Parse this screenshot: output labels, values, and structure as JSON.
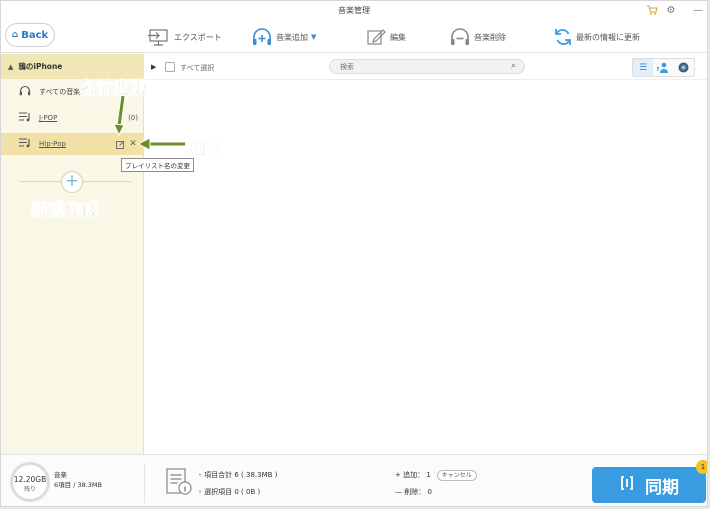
{
  "window": {
    "title": "音楽管理",
    "icons": [
      "cart-icon",
      "gear-icon",
      "minimize-icon"
    ]
  },
  "toolbar": {
    "back_label": "Back",
    "export_label": "エクスポート",
    "add_music_label": "音楽追加",
    "edit_label": "編集",
    "delete_music_label": "音楽削除",
    "refresh_label": "最新の情報に更新"
  },
  "sidebar": {
    "device_name": "鴉のiPhone",
    "items": [
      {
        "label": "すべての音楽",
        "count": "",
        "icon": "headphones-icon"
      },
      {
        "label": "J-POP",
        "count": "(0)",
        "icon": "playlist-icon"
      },
      {
        "label": "Hip-Pop",
        "count": "",
        "icon": "playlist-icon",
        "selected": true
      }
    ],
    "tooltip": "プレイリスト名の変更"
  },
  "content": {
    "select_all_label": "すべて選択",
    "search_placeholder": "検索"
  },
  "bottom": {
    "storage_value": "12.20GB",
    "storage_sub": "残り",
    "category": "音楽",
    "category_detail": "6項目 / 38.3MB",
    "total_items": "項目合計 6 ( 38.3MB )",
    "selected_items": "選択項目 0 ( 0B )",
    "add_label": "追加： 1",
    "cancel_label": "キャンセル",
    "delete_label": "削除： 0",
    "sync_label": "同期",
    "badge": "1"
  },
  "annotations": {
    "rename": "名前変更",
    "delete": "削除",
    "new_create": "新規作成"
  },
  "colors": {
    "accent": "#3a9ce0",
    "sidebar_bg": "#fbf7e6",
    "selected_bg": "#f1e1a6",
    "annotation": "#6a8d2a"
  }
}
